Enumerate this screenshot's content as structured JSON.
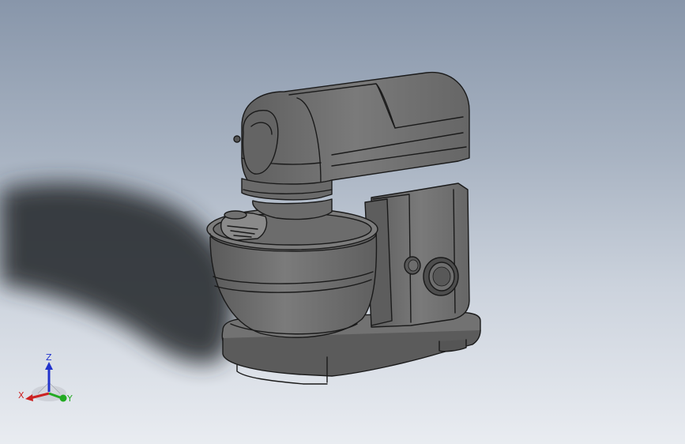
{
  "viewport": {
    "background_top": "#8896aa",
    "background_bottom": "#e9ecf1",
    "model_fill": "#6f6f6f",
    "model_edge": "#1a1a1a",
    "shadow_color": "#2a2d33"
  },
  "triad": {
    "x_label": "X",
    "y_label": "Y",
    "z_label": "Z",
    "x_color": "#cc2222",
    "y_color": "#22aa22",
    "z_color": "#2233cc"
  }
}
